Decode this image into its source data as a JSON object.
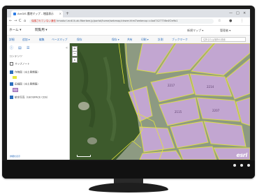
{
  "browser": {
    "tab_title": "ArcGIS 農地マップ - 地図表示",
    "tab_close": "×",
    "new_tab": "+",
    "url_insecure_label": "保護されていない通信",
    "url": "hmaduri.ecdl.lk.ab.fiberbee.jp/portal/home/webmap/viewer.html?webmap=c4ad7427736e4f2e9b1",
    "window_controls": [
      "—",
      "□",
      "×"
    ],
    "nav": [
      "←",
      "→",
      "C",
      "⌂"
    ],
    "icons": [
      "☆",
      "●",
      "⋮"
    ]
  },
  "app": {
    "home_link": "ホーム ▾",
    "map_title": "閲覧用 ▾",
    "new_map": "新規マップ ▾",
    "user": "管理者 ▾"
  },
  "toolbar": {
    "buttons": [
      "詳細",
      "追加 ▾",
      "編集",
      "ベースマップ",
      "保存"
    ],
    "right_buttons": [
      "保存 ▾",
      "共有",
      "印刷 ▾",
      "計測",
      "ブックマーク"
    ],
    "search_placeholder": "住所または場所の検索"
  },
  "sidebar": {
    "heading": "コンテンツ",
    "layers": [
      {
        "label": "マップノート",
        "checked": false
      },
      {
        "label": "作物図（水土里情報）",
        "checked": true
      },
      {
        "label": "田畑図（水土里情報）",
        "checked": true
      },
      {
        "label": "航空写真（GEOSPACE CDS）",
        "checked": true
      }
    ],
    "link": "詳細を表示"
  },
  "map": {
    "zoom_in": "+",
    "zoom_out": "−",
    "home": "⌂",
    "attribution": "esri",
    "parcel_labels": [
      "2217",
      "2214",
      "2115",
      "2207"
    ]
  },
  "colors": {
    "parcel_fill": "#c7a7d8",
    "parcel_outline": "#e5e63c",
    "forest": "#3d5a2c",
    "accent": "#2c6ebd"
  }
}
